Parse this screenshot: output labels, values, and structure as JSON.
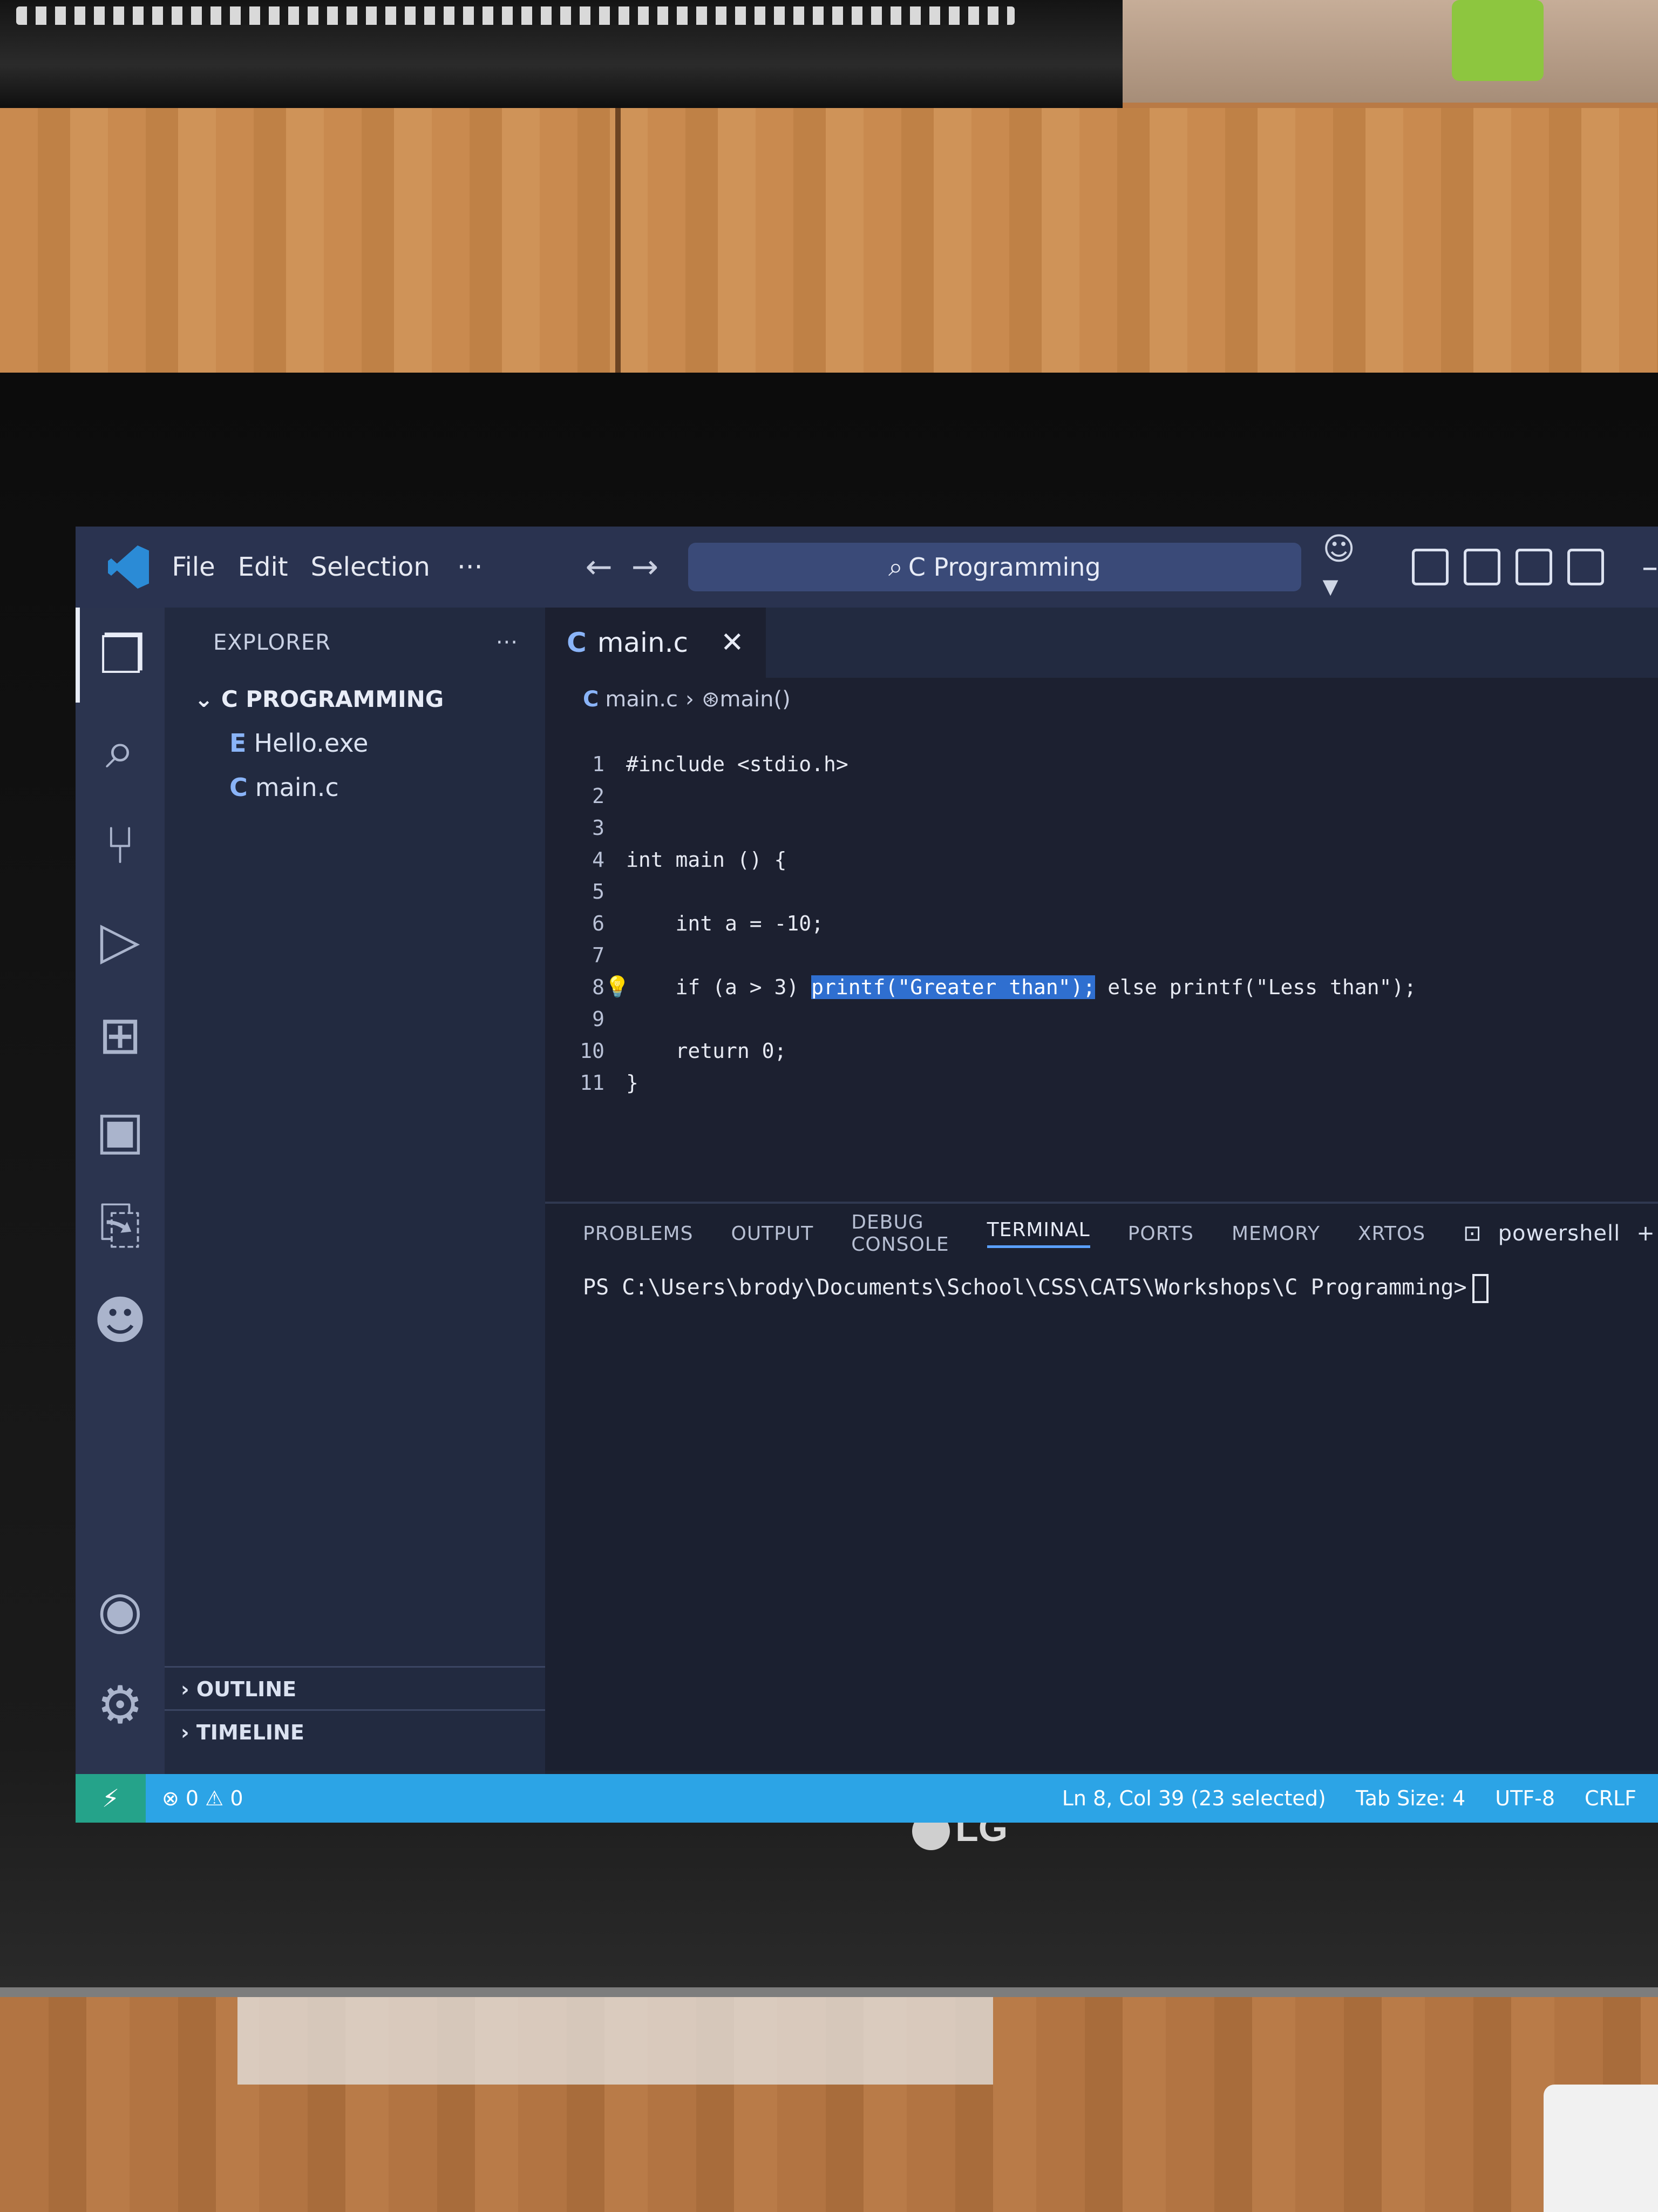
{
  "window": {
    "menu": [
      "File",
      "Edit",
      "Selection"
    ],
    "more": "···",
    "search_text": "C Programming"
  },
  "explorer": {
    "title": "EXPLORER",
    "folder": "C PROGRAMMING",
    "files": [
      {
        "icon": "E",
        "name": "Hello.exe"
      },
      {
        "icon": "C",
        "name": "main.c"
      }
    ],
    "outline": "OUTLINE",
    "timeline": "TIMELINE"
  },
  "editor": {
    "tab": {
      "icon": "C",
      "name": "main.c"
    },
    "breadcrumb": {
      "file": "main.c",
      "symbol": "main()"
    },
    "lines": [
      {
        "n": "1",
        "text": "#include <stdio.h>"
      },
      {
        "n": "2",
        "text": ""
      },
      {
        "n": "3",
        "text": ""
      },
      {
        "n": "4",
        "text": "int main () {"
      },
      {
        "n": "5",
        "text": ""
      },
      {
        "n": "6",
        "text": "    int a = -10;"
      },
      {
        "n": "7",
        "text": ""
      },
      {
        "n": "8",
        "pre": "    if (a > 3) ",
        "selected": "printf(\"Greater than\");",
        "post": " else printf(\"Less than\");"
      },
      {
        "n": "9",
        "text": ""
      },
      {
        "n": "10",
        "text": "    return 0;"
      },
      {
        "n": "11",
        "text": "}"
      }
    ]
  },
  "panel": {
    "tabs": [
      "PROBLEMS",
      "OUTPUT",
      "DEBUG CONSOLE",
      "TERMINAL",
      "PORTS",
      "MEMORY",
      "XRTOS"
    ],
    "active_tab": "TERMINAL",
    "shell": "powershell",
    "terminal_line": "PS C:\\Users\\brody\\Documents\\School\\CSS\\CATS\\Workshops\\C Programming>"
  },
  "status": {
    "problems": "⊗ 0 ⚠ 0",
    "position": "Ln 8, Col 39 (23 selected)",
    "tab_size": "Tab Size: 4",
    "encoding": "UTF-8",
    "eol": "CRLF"
  },
  "monitor": {
    "brand": "LG"
  }
}
